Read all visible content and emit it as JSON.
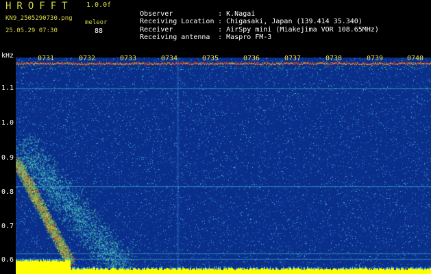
{
  "header": {
    "app_title": "HROFFT",
    "version": "1.0.0f",
    "file_name": "KN9_2505290730.png",
    "mode_label": "meleor",
    "timestamp": "25.05.29 07:30",
    "count": "88",
    "info": [
      {
        "key": "Observer",
        "value": ": K.Nagai"
      },
      {
        "key": "Receiving Location",
        "value": ": Chigasaki, Japan (139.414 35.340)"
      },
      {
        "key": "Receiver",
        "value": ": AirSpy mini (Miakejima VOR 108.65MHz)"
      },
      {
        "key": "Receiving antenna",
        "value": ": Maspro FM-3"
      }
    ]
  },
  "spectrogram": {
    "unit_label": "kHz",
    "y_ticks": [
      "1.1",
      "1.0",
      "0.9",
      "0.8",
      "0.7",
      "0.6"
    ],
    "time_ticks": [
      "0731",
      "0732",
      "0733",
      "0734",
      "0735",
      "0736",
      "0737",
      "0738",
      "0739",
      "0740"
    ],
    "colors": {
      "background": "#0a2f8a",
      "noise": "#2a7ad0",
      "signal_red": "#ff3b1e",
      "signal_yellow": "#ffff00",
      "header_text": "#d8d84a"
    }
  }
}
